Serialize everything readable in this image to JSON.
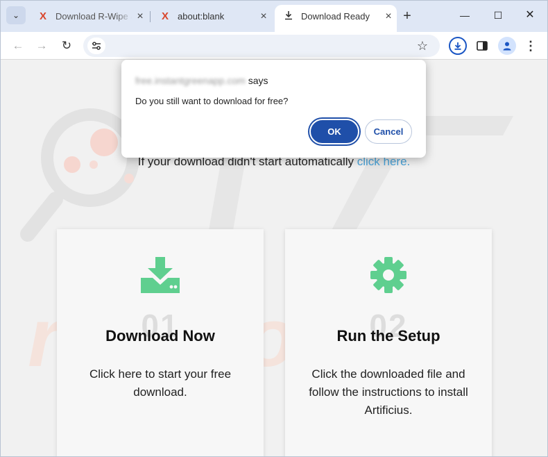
{
  "browser": {
    "tabs": [
      {
        "title": "Download R-Wipe &",
        "icon": "x-logo-icon"
      },
      {
        "title": "about:blank",
        "icon": "x-logo-icon"
      },
      {
        "title": "Download Ready",
        "icon": "download-icon"
      }
    ],
    "active_tab_index": 2,
    "address": "",
    "window_controls": {
      "minimize": "—",
      "maximize": "☐",
      "close": "✕"
    }
  },
  "page": {
    "fallback_text": "If your download didn't start automatically",
    "fallback_link": "click here.",
    "watermark": "PC risk.com",
    "steps": [
      {
        "number": "01",
        "title": "Download Now",
        "description": "Click here to start your free download.",
        "icon": "download-tray-icon"
      },
      {
        "number": "02",
        "title": "Run the Setup",
        "description": "Click the downloaded file and follow the instructions to install Artificius.",
        "icon": "gear-icon"
      }
    ]
  },
  "dialog": {
    "origin_host": "free.instantgreenapp.com",
    "origin_suffix": "says",
    "message": "Do you still want to download for free?",
    "ok_label": "OK",
    "cancel_label": "Cancel"
  },
  "colors": {
    "accent": "#1f4fa9",
    "step_icon": "#5fcf8f",
    "link": "#4aa3d8",
    "tab_strip": "#dfe7f5",
    "favicon_red": "#d9452b"
  }
}
